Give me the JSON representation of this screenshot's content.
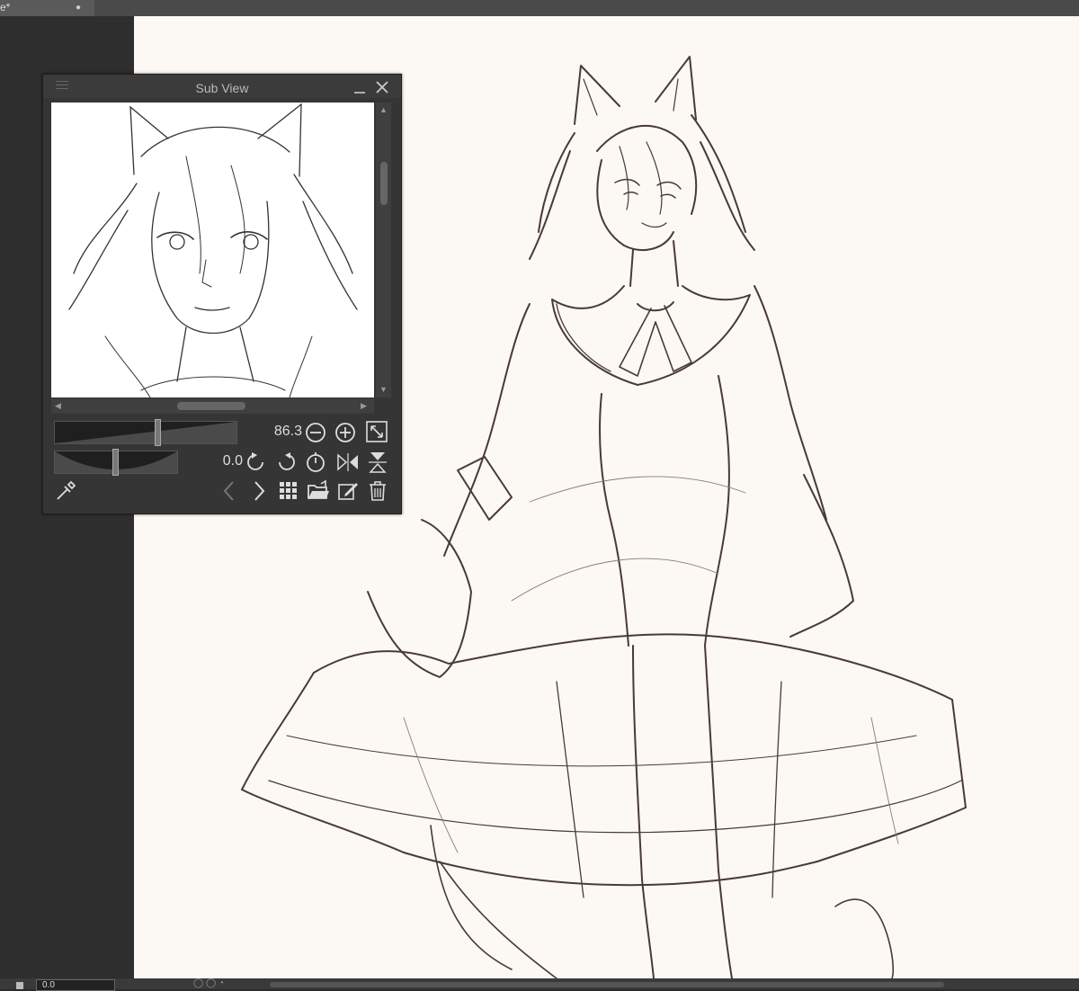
{
  "tab": {
    "title": "e*",
    "modified_dot": "●"
  },
  "subview": {
    "title": "Sub View",
    "zoom_value": "86.3",
    "rotation_value": "0.0"
  },
  "statusbar": {
    "zoom": "0.0"
  },
  "icons": {
    "menu": "menu-icon",
    "minimize": "minimize-icon",
    "close": "close-icon",
    "zoom_out": "zoom-out-icon",
    "zoom_in": "zoom-in-icon",
    "fit": "fit-to-window-icon",
    "rotate_left": "rotate-left-icon",
    "rotate_right": "rotate-right-icon",
    "reset_rotation": "reset-rotation-icon",
    "flip_horizontal": "flip-horizontal-icon",
    "flip_vertical": "flip-vertical-icon",
    "eyedropper": "eyedropper-icon",
    "previous": "chevron-left-icon",
    "next": "chevron-right-icon",
    "thumbnails": "grid-icon",
    "open": "open-folder-icon",
    "edit": "edit-icon",
    "delete": "trash-icon"
  },
  "colors": {
    "canvas": "#fcf8f4",
    "panel": "#353535",
    "sketch_line": "#4a3a34"
  }
}
